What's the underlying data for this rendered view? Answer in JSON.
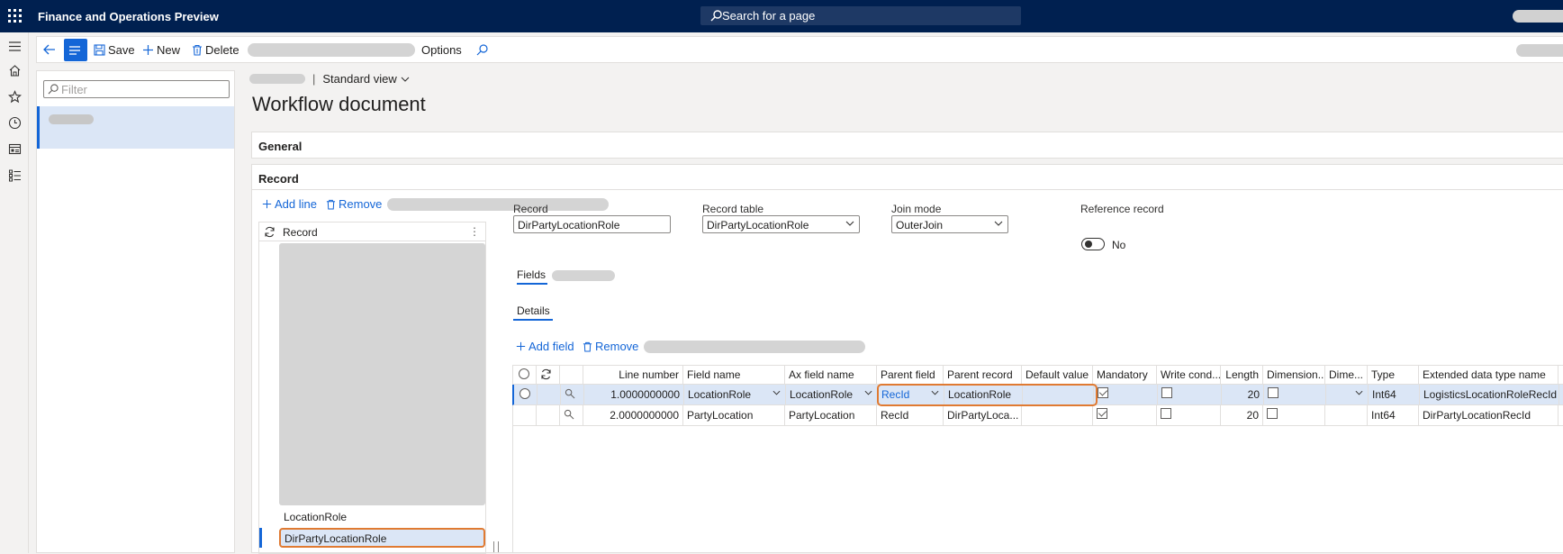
{
  "app": {
    "title": "Finance and Operations Preview",
    "search_label": "Search for a page"
  },
  "actionbar": {
    "save_label": "Save",
    "new_label": "New",
    "delete_label": "Delete",
    "options_label": "Options"
  },
  "listpane": {
    "filter_placeholder": "Filter"
  },
  "page": {
    "view_label": "Standard view",
    "title": "Workflow document"
  },
  "fasttabs": {
    "general": "General",
    "record": "Record"
  },
  "record_tab": {
    "add_line": "Add line",
    "remove": "Remove",
    "tree_header": "Record",
    "tree_items": [
      "LocationRole",
      "DirPartyLocationRole"
    ]
  },
  "record_fields": {
    "record_label": "Record",
    "record_value": "DirPartyLocationRole",
    "record_table_label": "Record table",
    "record_table_value": "DirPartyLocationRole",
    "join_mode_label": "Join mode",
    "join_mode_value": "OuterJoin",
    "reference_record_label": "Reference record",
    "reference_record_value": "No"
  },
  "tabs": {
    "fields": "Fields",
    "details": "Details"
  },
  "details": {
    "add_field": "Add field",
    "remove": "Remove"
  },
  "grid": {
    "columns": [
      "Line number",
      "Field name",
      "Ax field name",
      "Parent field",
      "Parent record",
      "Default value",
      "Mandatory",
      "Write cond...",
      "Length",
      "Dimension...",
      "Dime...",
      "Type",
      "Extended data type name"
    ],
    "rows": [
      {
        "line": "1.0000000000",
        "field_name": "LocationRole",
        "ax_field_name": "LocationRole",
        "parent_field": "RecId",
        "parent_record": "LocationRole",
        "default_value": "",
        "mandatory": true,
        "write_cond": false,
        "length": "20",
        "dimension": false,
        "type": "Int64",
        "edt": "LogisticsLocationRoleRecId"
      },
      {
        "line": "2.0000000000",
        "field_name": "PartyLocation",
        "ax_field_name": "PartyLocation",
        "parent_field": "RecId",
        "parent_record": "DirPartyLoca...",
        "default_value": "",
        "mandatory": true,
        "write_cond": false,
        "length": "20",
        "dimension": false,
        "type": "Int64",
        "edt": "DirPartyLocationRecId"
      }
    ]
  }
}
